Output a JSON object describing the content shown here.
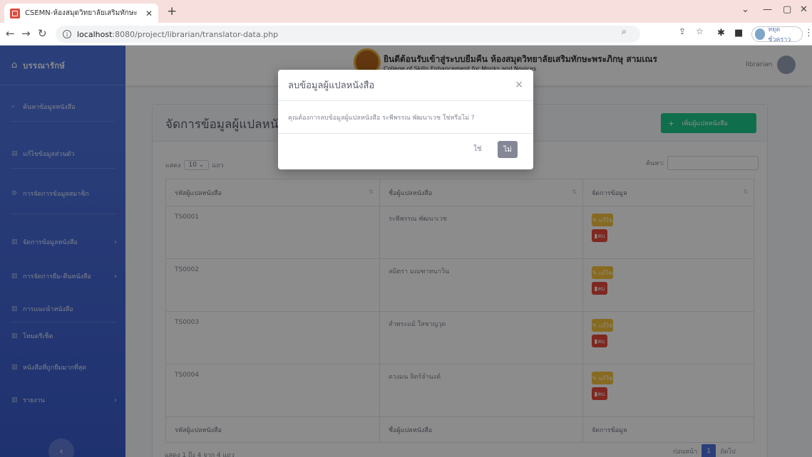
{
  "browser": {
    "tab_title": "CSEMN-ห้องสมุดวิทยาลัยเสริมทักษะ",
    "url_host": "localhost",
    "url_path": ":8080/project/librarian/translator-data.php",
    "profile_name": "หยุดชั่วคราว"
  },
  "sidebar": {
    "brand": "บรรณารักษ์",
    "items": [
      {
        "label": "ค้นหาข้อมูลหนังสือ"
      },
      {
        "label": "แก้ไขข้อมูลส่วนตัว"
      },
      {
        "label": "การจัดการข้อมูลสมาชิก"
      },
      {
        "label": "จัดการข้อมูลหนังสือ"
      },
      {
        "label": "การจัดการยืม-คืนหนังสือ"
      },
      {
        "label": "การแนะนำหนังสือ"
      },
      {
        "label": "โหมดรีเซ็ต"
      },
      {
        "label": "หนังสือที่ถูกยืมมากที่สุด"
      },
      {
        "label": "รายงาน"
      }
    ]
  },
  "topbar": {
    "college_th": "ยินดีต้อนรับเข้าสู่ระบบยืมคืน ห้องสมุดวิทยาลัยเสริมทักษะพระภิกษุ สามเณร",
    "college_en": "College of Skills Enhancement for Monks and Novices",
    "user": "librarian"
  },
  "main": {
    "title": "จัดการข้อมูลผู้แปลหนังสือ",
    "add_button": "เพิ่มผู้แปลหนังสือ",
    "show_label": "แสดง",
    "show_value": "10",
    "show_unit": "แถว",
    "search_label": "ค้นหา:",
    "columns": [
      "รหัสผู้แปลหนังสือ",
      "ชื่อผู้แปลหนังสือ",
      "จัดการข้อมูล"
    ],
    "rows": [
      {
        "id": "TS0001",
        "name": "ระพีพรรณ พัฒนาเวช"
      },
      {
        "id": "TS0002",
        "name": "สมิตรา มณฑาทนาวิน"
      },
      {
        "id": "TS0003",
        "name": "สำพระแม้ ใสชาญวุด"
      },
      {
        "id": "TS0004",
        "name": "ดวงมน จิตร์จำนงค์"
      }
    ],
    "edit_label": "แก้ไข",
    "delete_label": "ลบ",
    "info": "แสดง 1 ถึง 4 จาก 4 แถว",
    "prev": "ก่อนหน้า",
    "page": "1",
    "next": "ถัดไป"
  },
  "modal": {
    "title": "ลบข้อมูลผู้แปลหนังสือ",
    "body": "คุณต้องการลบข้อมูลผู้แปลหนังสือ ระพีพรรณ พัฒนาเวช ใช่หรือไม่ ?",
    "yes": "ใช่",
    "no": "ไม่"
  }
}
